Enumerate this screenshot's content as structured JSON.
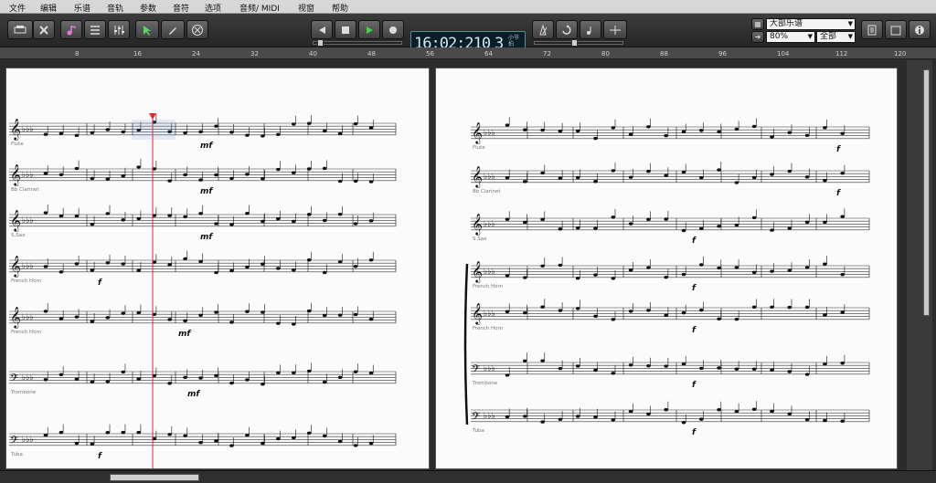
{
  "menu": [
    "文件",
    "编辑",
    "乐谱",
    "音轨",
    "参数",
    "音符",
    "选项",
    "音频/ MIDI",
    "视窗",
    "帮助"
  ],
  "transport": {
    "time": "16:02:210",
    "measure": "3",
    "measure_label_top": "小节",
    "measure_label_bottom": "拍"
  },
  "style_select": {
    "value": "大部乐谱"
  },
  "zoom_select": {
    "value": "80%"
  },
  "parts_select": {
    "value": "全部"
  },
  "ruler_ticks": [
    "8",
    "16",
    "24",
    "32",
    "40",
    "48",
    "56",
    "64",
    "72",
    "80",
    "88",
    "96",
    "104",
    "112",
    "120"
  ],
  "left_page": {
    "instruments": [
      "Flute",
      "Bb Clarinet",
      "S.Sax",
      "French Horn",
      "French Horn",
      "Trombone",
      "Tuba"
    ]
  },
  "right_page": {
    "instruments": [
      "Flute",
      "Bb Clarinet",
      "S.Sax",
      "French Horn",
      "French Horn",
      "Trombone",
      "Tuba"
    ]
  },
  "dynamics": [
    "mf",
    "f"
  ],
  "icons": [
    "print-icon",
    "tools-icon",
    "note-icon",
    "list-icon",
    "mixer-icon",
    "cursor-icon",
    "pencil-icon",
    "eraser-icon",
    "rewind-icon",
    "stop-icon",
    "play-icon",
    "record-icon",
    "metronome-icon",
    "loop-icon",
    "count-in-icon",
    "click-icon",
    "score-icon",
    "info-icon"
  ]
}
